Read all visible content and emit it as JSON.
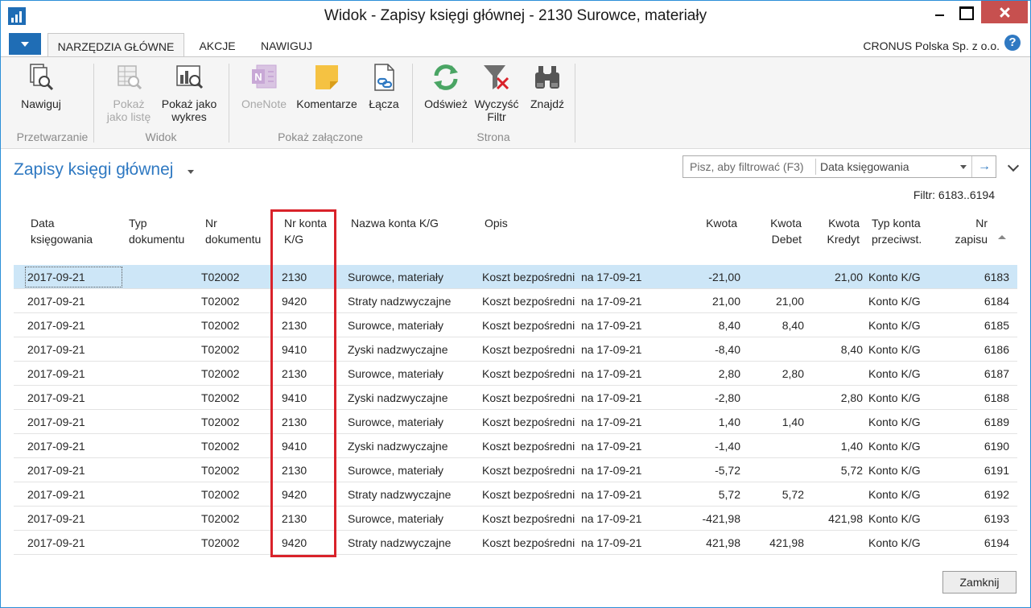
{
  "window": {
    "title": "Widok - Zapisy księgi głównej - 2130 Surowce, materiały"
  },
  "ribbon_tabs": [
    "NARZĘDZIA GŁÓWNE",
    "AKCJE",
    "NAWIGUJ"
  ],
  "company": "CRONUS Polska Sp. z o.o.",
  "ribbon": {
    "navigate": "Nawiguj",
    "show_list": [
      "Pokaż",
      "jako listę"
    ],
    "show_chart": [
      "Pokaż jako",
      "wykres"
    ],
    "onenote": "OneNote",
    "comments": "Komentarze",
    "links": "Łącza",
    "refresh": "Odśwież",
    "clear_filter": [
      "Wyczyść",
      "Filtr"
    ],
    "find": "Znajdź",
    "groups": {
      "processing": "Przetwarzanie",
      "view": "Widok",
      "attached": "Pokaż załączone",
      "page": "Strona"
    }
  },
  "page": {
    "title": "Zapisy księgi głównej",
    "filter_placeholder": "Pisz, aby filtrować (F3)",
    "filter_field": "Data księgowania",
    "filter_info": "Filtr: 6183..6194"
  },
  "columns": {
    "posting_date": [
      "Data",
      "księgowania"
    ],
    "doc_type": [
      "Typ",
      "dokumentu"
    ],
    "doc_no": [
      "Nr",
      "dokumentu"
    ],
    "gl_account_no": [
      "Nr konta",
      "K/G"
    ],
    "gl_account_name": "Nazwa konta K/G",
    "description": "Opis",
    "amount": "Kwota",
    "debit": [
      "Kwota",
      "Debet"
    ],
    "credit": [
      "Kwota",
      "Kredyt"
    ],
    "bal_account_type": [
      "Typ konta",
      "przeciwst."
    ],
    "entry_no": [
      "Nr",
      "zapisu"
    ]
  },
  "rows": [
    {
      "date": "2017-09-21",
      "doc_no": "T02002",
      "acc": "2130",
      "name": "Surowce, materiały",
      "desc": "Koszt bezpośredni  na 17-09-21",
      "amount": "-21,00",
      "debit": "",
      "credit": "21,00",
      "bal_type": "Konto K/G",
      "entry": "6183"
    },
    {
      "date": "2017-09-21",
      "doc_no": "T02002",
      "acc": "9420",
      "name": "Straty nadzwyczajne",
      "desc": "Koszt bezpośredni  na 17-09-21",
      "amount": "21,00",
      "debit": "21,00",
      "credit": "",
      "bal_type": "Konto K/G",
      "entry": "6184"
    },
    {
      "date": "2017-09-21",
      "doc_no": "T02002",
      "acc": "2130",
      "name": "Surowce, materiały",
      "desc": "Koszt bezpośredni  na 17-09-21",
      "amount": "8,40",
      "debit": "8,40",
      "credit": "",
      "bal_type": "Konto K/G",
      "entry": "6185"
    },
    {
      "date": "2017-09-21",
      "doc_no": "T02002",
      "acc": "9410",
      "name": "Zyski nadzwyczajne",
      "desc": "Koszt bezpośredni  na 17-09-21",
      "amount": "-8,40",
      "debit": "",
      "credit": "8,40",
      "bal_type": "Konto K/G",
      "entry": "6186"
    },
    {
      "date": "2017-09-21",
      "doc_no": "T02002",
      "acc": "2130",
      "name": "Surowce, materiały",
      "desc": "Koszt bezpośredni  na 17-09-21",
      "amount": "2,80",
      "debit": "2,80",
      "credit": "",
      "bal_type": "Konto K/G",
      "entry": "6187"
    },
    {
      "date": "2017-09-21",
      "doc_no": "T02002",
      "acc": "9410",
      "name": "Zyski nadzwyczajne",
      "desc": "Koszt bezpośredni  na 17-09-21",
      "amount": "-2,80",
      "debit": "",
      "credit": "2,80",
      "bal_type": "Konto K/G",
      "entry": "6188"
    },
    {
      "date": "2017-09-21",
      "doc_no": "T02002",
      "acc": "2130",
      "name": "Surowce, materiały",
      "desc": "Koszt bezpośredni  na 17-09-21",
      "amount": "1,40",
      "debit": "1,40",
      "credit": "",
      "bal_type": "Konto K/G",
      "entry": "6189"
    },
    {
      "date": "2017-09-21",
      "doc_no": "T02002",
      "acc": "9410",
      "name": "Zyski nadzwyczajne",
      "desc": "Koszt bezpośredni  na 17-09-21",
      "amount": "-1,40",
      "debit": "",
      "credit": "1,40",
      "bal_type": "Konto K/G",
      "entry": "6190"
    },
    {
      "date": "2017-09-21",
      "doc_no": "T02002",
      "acc": "2130",
      "name": "Surowce, materiały",
      "desc": "Koszt bezpośredni  na 17-09-21",
      "amount": "-5,72",
      "debit": "",
      "credit": "5,72",
      "bal_type": "Konto K/G",
      "entry": "6191"
    },
    {
      "date": "2017-09-21",
      "doc_no": "T02002",
      "acc": "9420",
      "name": "Straty nadzwyczajne",
      "desc": "Koszt bezpośredni  na 17-09-21",
      "amount": "5,72",
      "debit": "5,72",
      "credit": "",
      "bal_type": "Konto K/G",
      "entry": "6192"
    },
    {
      "date": "2017-09-21",
      "doc_no": "T02002",
      "acc": "2130",
      "name": "Surowce, materiały",
      "desc": "Koszt bezpośredni  na 17-09-21",
      "amount": "-421,98",
      "debit": "",
      "credit": "421,98",
      "bal_type": "Konto K/G",
      "entry": "6193"
    },
    {
      "date": "2017-09-21",
      "doc_no": "T02002",
      "acc": "9420",
      "name": "Straty nadzwyczajne",
      "desc": "Koszt bezpośredni  na 17-09-21",
      "amount": "421,98",
      "debit": "421,98",
      "credit": "",
      "bal_type": "Konto K/G",
      "entry": "6194"
    }
  ],
  "close_button": "Zamknij"
}
